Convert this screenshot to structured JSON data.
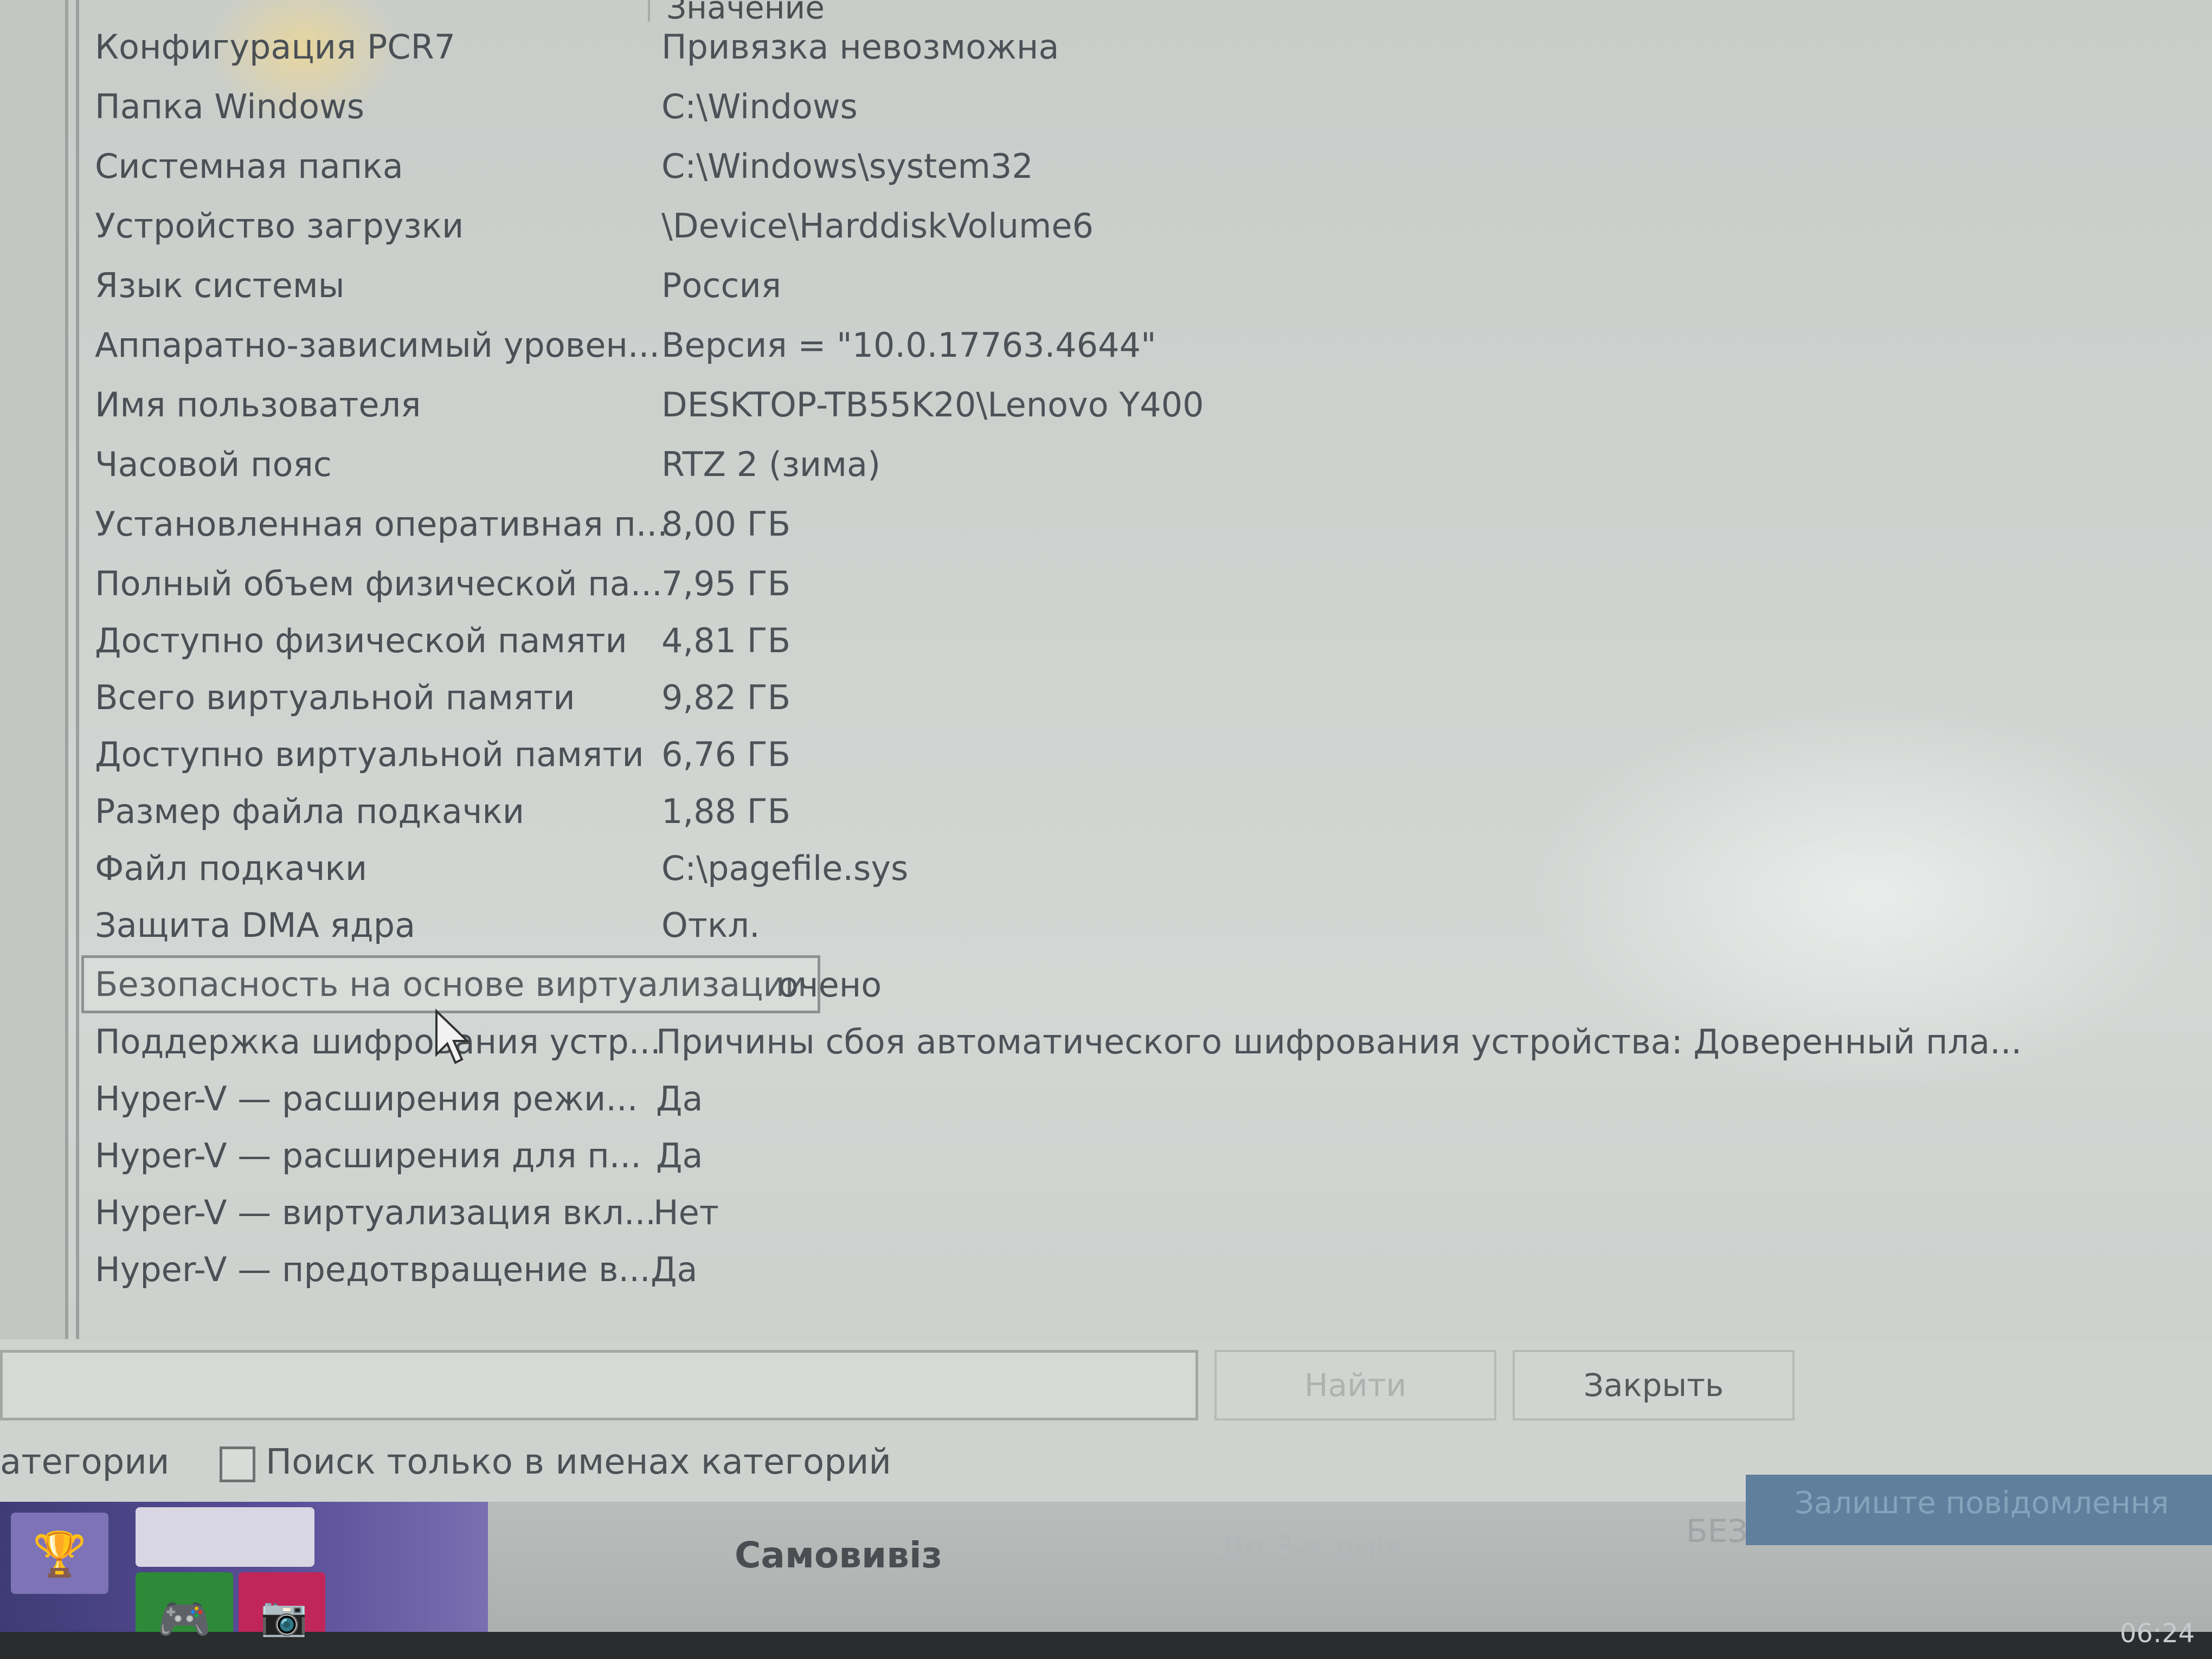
{
  "list": {
    "value_header": "Значение",
    "rows": [
      {
        "name": "Конфигурация PCR7",
        "value": "Привязка невозможна"
      },
      {
        "name": "Папка Windows",
        "value": "C:\\Windows"
      },
      {
        "name": "Системная папка",
        "value": "C:\\Windows\\system32"
      },
      {
        "name": "Устройство загрузки",
        "value": "\\Device\\HarddiskVolume6"
      },
      {
        "name": "Язык системы",
        "value": "Россия"
      },
      {
        "name": "Аппаратно-зависимый уровен...",
        "value": "Версия = \"10.0.17763.4644\""
      },
      {
        "name": "Имя пользователя",
        "value": "DESKTOP-TB55K20\\Lenovo Y400"
      },
      {
        "name": "Часовой пояс",
        "value": "RTZ 2 (зима)"
      },
      {
        "name": "Установленная оперативная п...",
        "value": "8,00 ГБ"
      },
      {
        "name": "Полный объем физической па...",
        "value": "7,95 ГБ"
      },
      {
        "name": "Доступно физической памяти",
        "value": "4,81 ГБ"
      },
      {
        "name": "Всего виртуальной памяти",
        "value": "9,82 ГБ"
      },
      {
        "name": "Доступно виртуальной памяти",
        "value": "6,76 ГБ"
      },
      {
        "name": "Размер файла подкачки",
        "value": "1,88 ГБ"
      },
      {
        "name": "Файл подкачки",
        "value": "C:\\pagefile.sys"
      },
      {
        "name": "Защита DMA ядра",
        "value": "Откл."
      },
      {
        "name": "Безопасность на основе виртуализации",
        "value": "очено"
      },
      {
        "name": "Поддержка шифрования устр...",
        "value": "Причины сбоя автоматического шифрования устройства: Доверенный пла..."
      },
      {
        "name": "Hyper-V — расширения режи...",
        "value": "Да"
      },
      {
        "name": "Hyper-V — расширения для п...",
        "value": "Да"
      },
      {
        "name": "Hyper-V — виртуализация вкл...",
        "value": "Нет"
      },
      {
        "name": "Hyper-V — предотвращение в...",
        "value": "Да"
      }
    ],
    "selected_index": 16
  },
  "search": {
    "find_label": "Найти",
    "close_label": "Закрыть",
    "categories_label": "атегории",
    "category_only_label": "Поиск только в именах категорий",
    "category_only_checked": false
  },
  "background": {
    "pickup_text": "Самовивіз",
    "delivery_text": "До 3-х днів",
    "bez_text": "БЕЗ",
    "notify_text": "Залиште повідомлення",
    "clock_text": "06:24"
  },
  "icons": {
    "tile_1": "trophy-icon",
    "tile_3": "gamepad-icon",
    "tile_4": "camera-icon",
    "cursor": "mouse-cursor-icon"
  },
  "colors": {
    "text": "#4a5055",
    "tile_purple": "#7d73b6",
    "tile_green": "#2e8a39",
    "tile_pink": "#c0265a",
    "notify_blue": "#5f7f9c"
  }
}
